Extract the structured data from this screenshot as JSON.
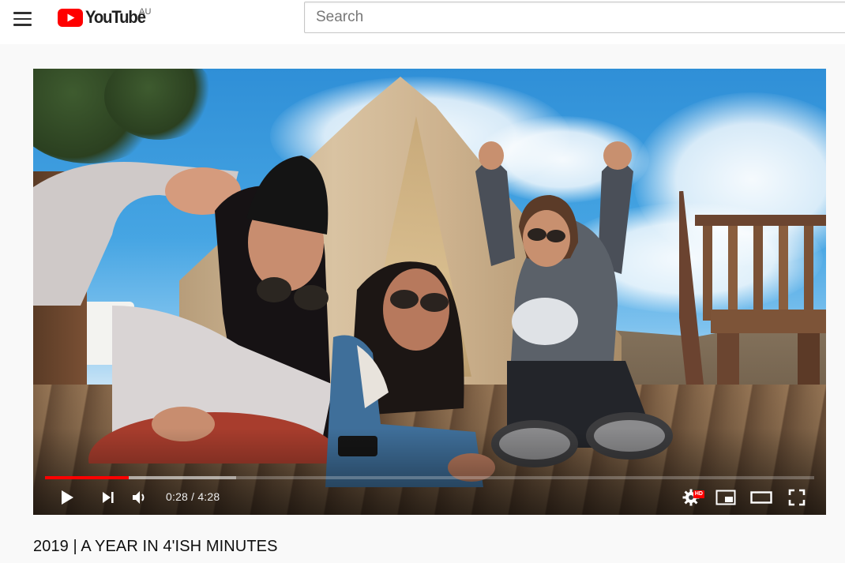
{
  "header": {
    "logo_text": "YouTube",
    "country_code": "AU",
    "search_placeholder": "Search"
  },
  "player": {
    "progress_played_fraction": 0.109,
    "progress_loaded_fraction": 0.248,
    "current_time": "0:28",
    "duration": "4:28",
    "time_display": "0:28 / 4:28",
    "quality_badge": "HD",
    "icons": [
      "play-icon",
      "next-icon",
      "volume-icon",
      "settings-icon",
      "miniplayer-icon",
      "theater-mode-icon",
      "fullscreen-icon"
    ]
  },
  "video": {
    "title": "2019 | A YEAR IN 4'ISH MINUTES"
  },
  "colors": {
    "brand_red": "#ff0000",
    "progress_red": "#ff0000",
    "page_background": "#f9f9f9"
  }
}
